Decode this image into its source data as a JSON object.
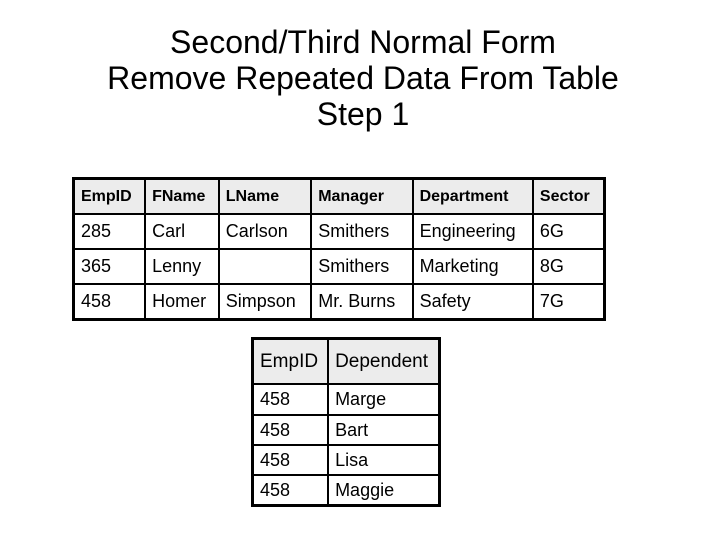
{
  "slide": {
    "title_lines": [
      "Second/Third Normal Form",
      "Remove Repeated Data From Table",
      "Step 1"
    ]
  },
  "employee_table": {
    "columns": [
      "EmpID",
      "FName",
      "LName",
      "Manager",
      "Department",
      "Sector"
    ],
    "rows": [
      [
        "285",
        "Carl",
        "Carlson",
        "Smithers",
        "Engineering",
        "6G"
      ],
      [
        "365",
        "Lenny",
        "",
        "Smithers",
        "Marketing",
        "8G"
      ],
      [
        "458",
        "Homer",
        "Simpson",
        "Mr. Burns",
        "Safety",
        "7G"
      ]
    ],
    "header_background": "#ececec"
  },
  "dependent_table": {
    "columns": [
      "EmpID",
      "Dependent"
    ],
    "rows": [
      [
        "458",
        "Marge"
      ],
      [
        "458",
        "Bart"
      ],
      [
        "458",
        "Lisa"
      ],
      [
        "458",
        "Maggie"
      ]
    ],
    "header_background": "#ececec"
  }
}
